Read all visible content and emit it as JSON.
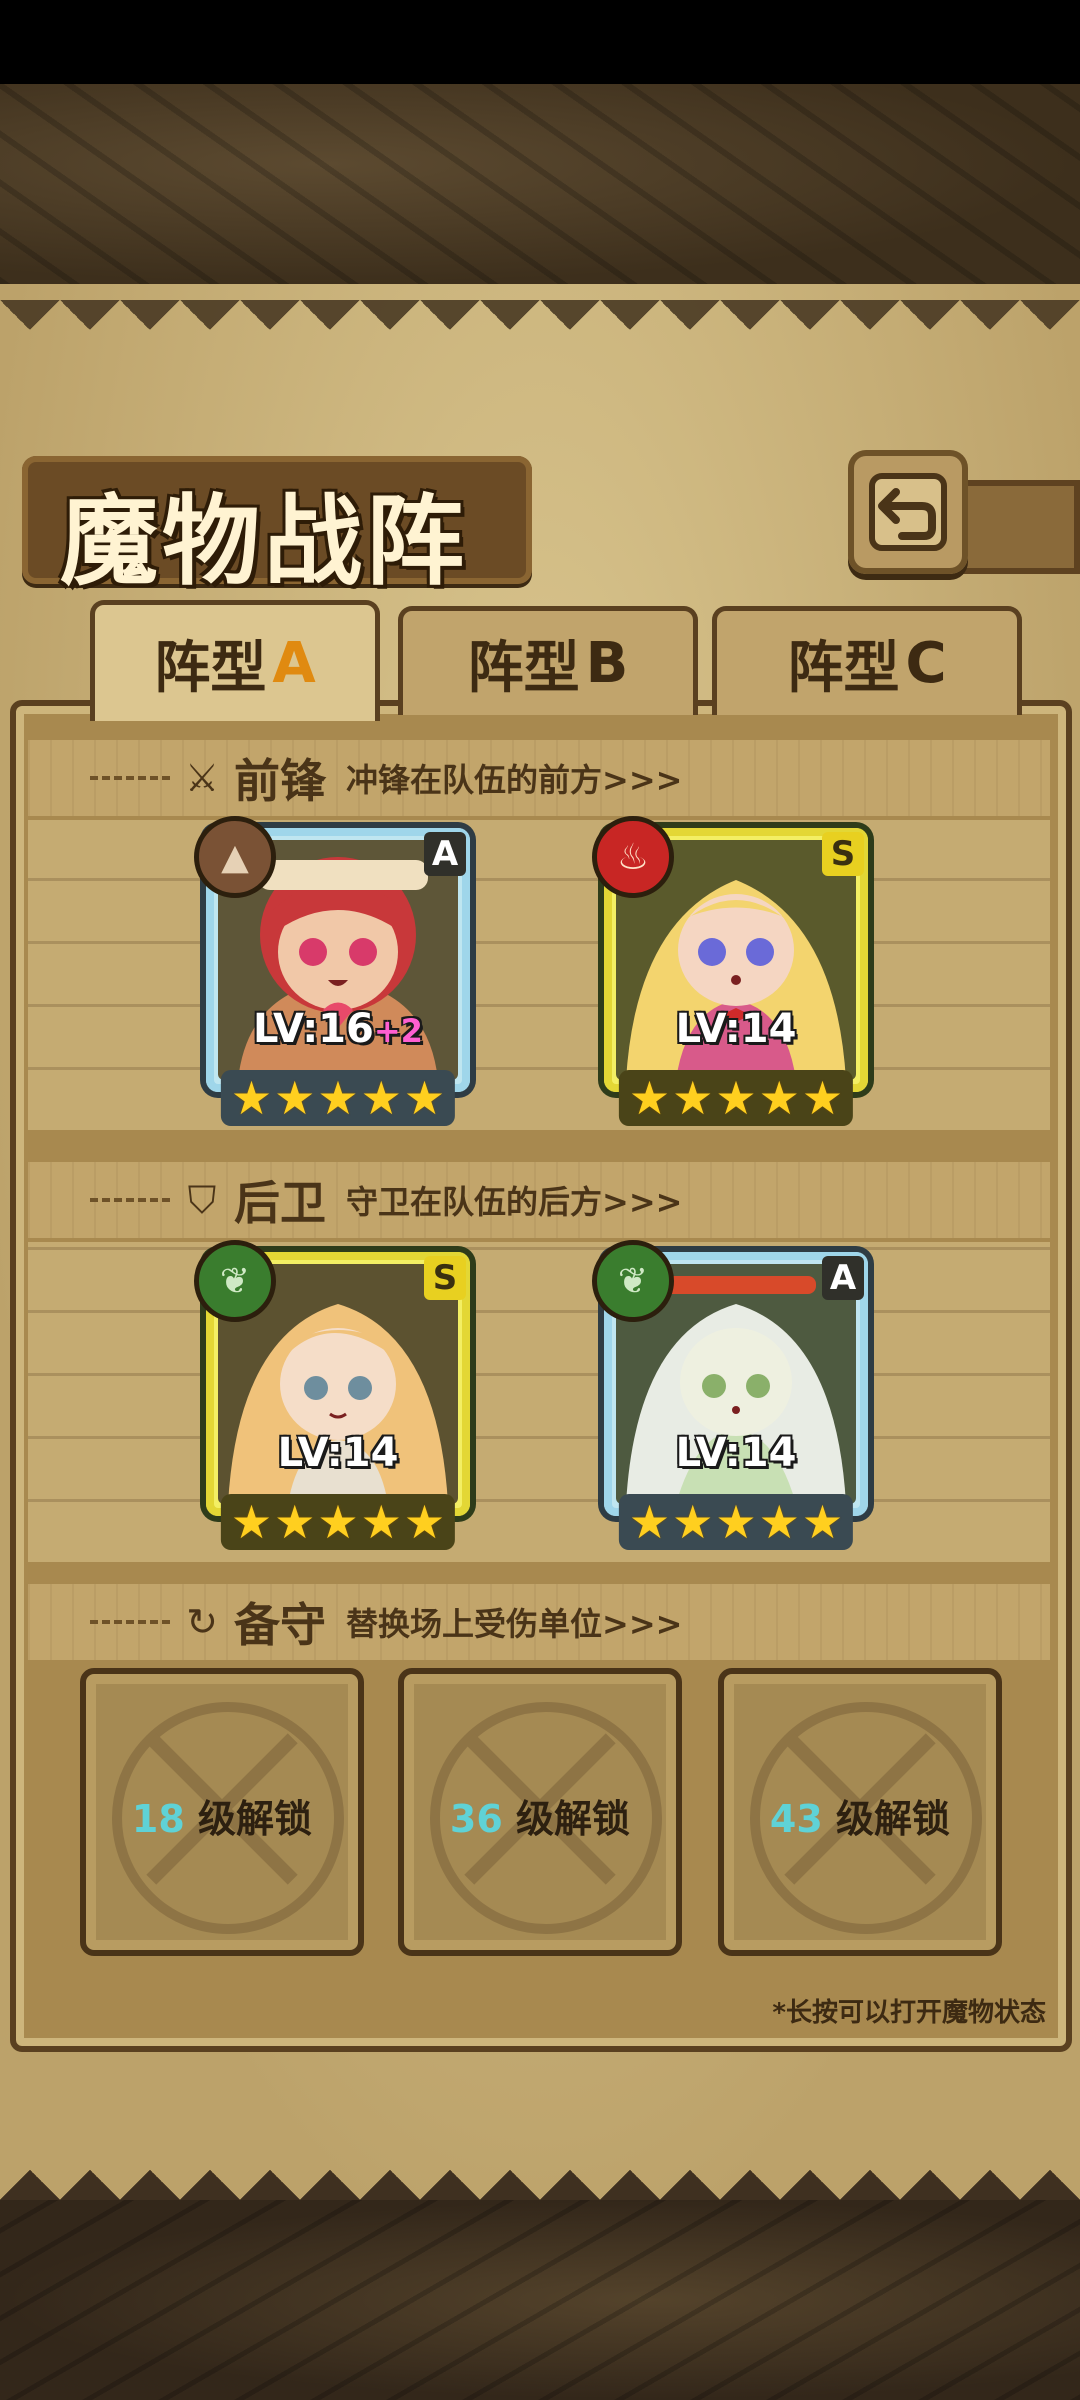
{
  "page": {
    "title": "魔物战阵"
  },
  "tabs": [
    {
      "label": "阵型",
      "letter": "A",
      "active": true
    },
    {
      "label": "阵型",
      "letter": "B",
      "active": false
    },
    {
      "label": "阵型",
      "letter": "C",
      "active": false
    }
  ],
  "sections": {
    "front": {
      "title": "前锋",
      "desc": "冲锋在队伍的前方>>>"
    },
    "back": {
      "title": "后卫",
      "desc": "守卫在队伍的后方>>>"
    },
    "reserve": {
      "title": "备守",
      "desc": "替换场上受伤单位>>>"
    }
  },
  "cards": [
    {
      "rank": "A",
      "element": "earth",
      "level": "LV:16",
      "bonus": "+2",
      "stars": 5,
      "colors": {
        "skin": "#f1c8a8",
        "hair": "#c8383a",
        "outfit": "#d08a5a"
      }
    },
    {
      "rank": "S",
      "element": "fire",
      "level": "LV:14",
      "bonus": "",
      "stars": 5,
      "colors": {
        "skin": "#f5d6c2",
        "hair": "#f3d46e",
        "outfit": "#d85a8a"
      }
    },
    {
      "rank": "S",
      "element": "leaf",
      "level": "LV:14",
      "bonus": "",
      "stars": 5,
      "colors": {
        "skin": "#f5ddc8",
        "hair": "#f0c27a",
        "outfit": "#e8e0d0"
      }
    },
    {
      "rank": "A",
      "element": "leaf",
      "level": "LV:14",
      "bonus": "",
      "stars": 5,
      "colors": {
        "skin": "#eef0e0",
        "hair": "#e8ece4",
        "outfit": "#c8e0b4"
      }
    }
  ],
  "slots": [
    {
      "num": "18",
      "text": "级解锁"
    },
    {
      "num": "36",
      "text": "级解锁"
    },
    {
      "num": "43",
      "text": "级解锁"
    }
  ],
  "footnote": "*长按可以打开魔物状态",
  "icons": {
    "back": "return-arrow-icon",
    "star": "★"
  }
}
